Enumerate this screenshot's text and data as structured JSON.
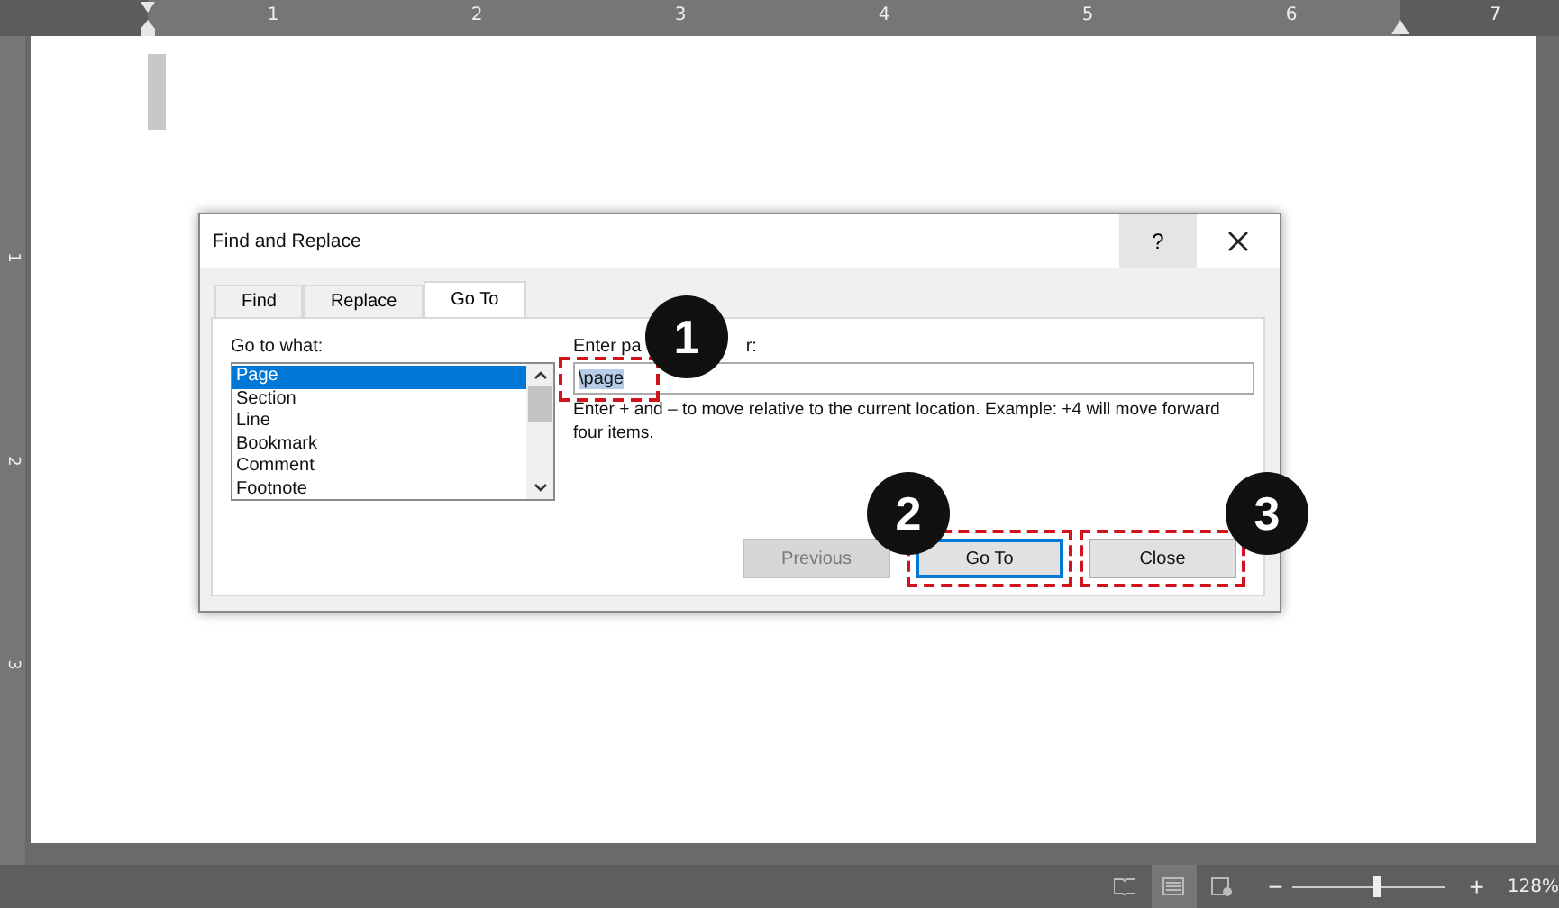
{
  "ruler": {
    "top_marks": [
      "1",
      "2",
      "3",
      "4",
      "5",
      "6",
      "7"
    ],
    "left_marks": [
      "1",
      "2",
      "3"
    ]
  },
  "dialog": {
    "title": "Find and Replace",
    "help_button": "?",
    "tabs": [
      {
        "label": "Find",
        "selected": false
      },
      {
        "label": "Replace",
        "selected": false
      },
      {
        "label": "Go To",
        "selected": true
      }
    ],
    "go_to_what": {
      "label": "Go to what:",
      "items": [
        {
          "label": "Page",
          "selected": true
        },
        {
          "label": "Section",
          "selected": false
        },
        {
          "label": "Line",
          "selected": false
        },
        {
          "label": "Bookmark",
          "selected": false
        },
        {
          "label": "Comment",
          "selected": false
        },
        {
          "label": "Footnote",
          "selected": false
        }
      ]
    },
    "entry": {
      "label_parts": [
        "Enter pa",
        "r:"
      ],
      "value": "\\page",
      "value_selected": true,
      "highlighted": true,
      "hint": "Enter + and – to move relative to the current location. Example: +4 will move forward four items."
    },
    "buttons": [
      {
        "label": "Previous",
        "disabled": true,
        "default": false,
        "highlighted": false
      },
      {
        "label": "Go To",
        "disabled": false,
        "default": true,
        "highlighted": true
      },
      {
        "label": "Close",
        "disabled": false,
        "default": false,
        "highlighted": true
      }
    ]
  },
  "callouts": [
    {
      "number": "1"
    },
    {
      "number": "2"
    },
    {
      "number": "3"
    }
  ],
  "status_bar": {
    "views": [
      {
        "kind": "read",
        "selected": false
      },
      {
        "kind": "print",
        "selected": true
      },
      {
        "kind": "web",
        "selected": false
      }
    ],
    "zoom": {
      "minus": "−",
      "plus": "+",
      "level": 0.55,
      "reading": "128%"
    }
  }
}
